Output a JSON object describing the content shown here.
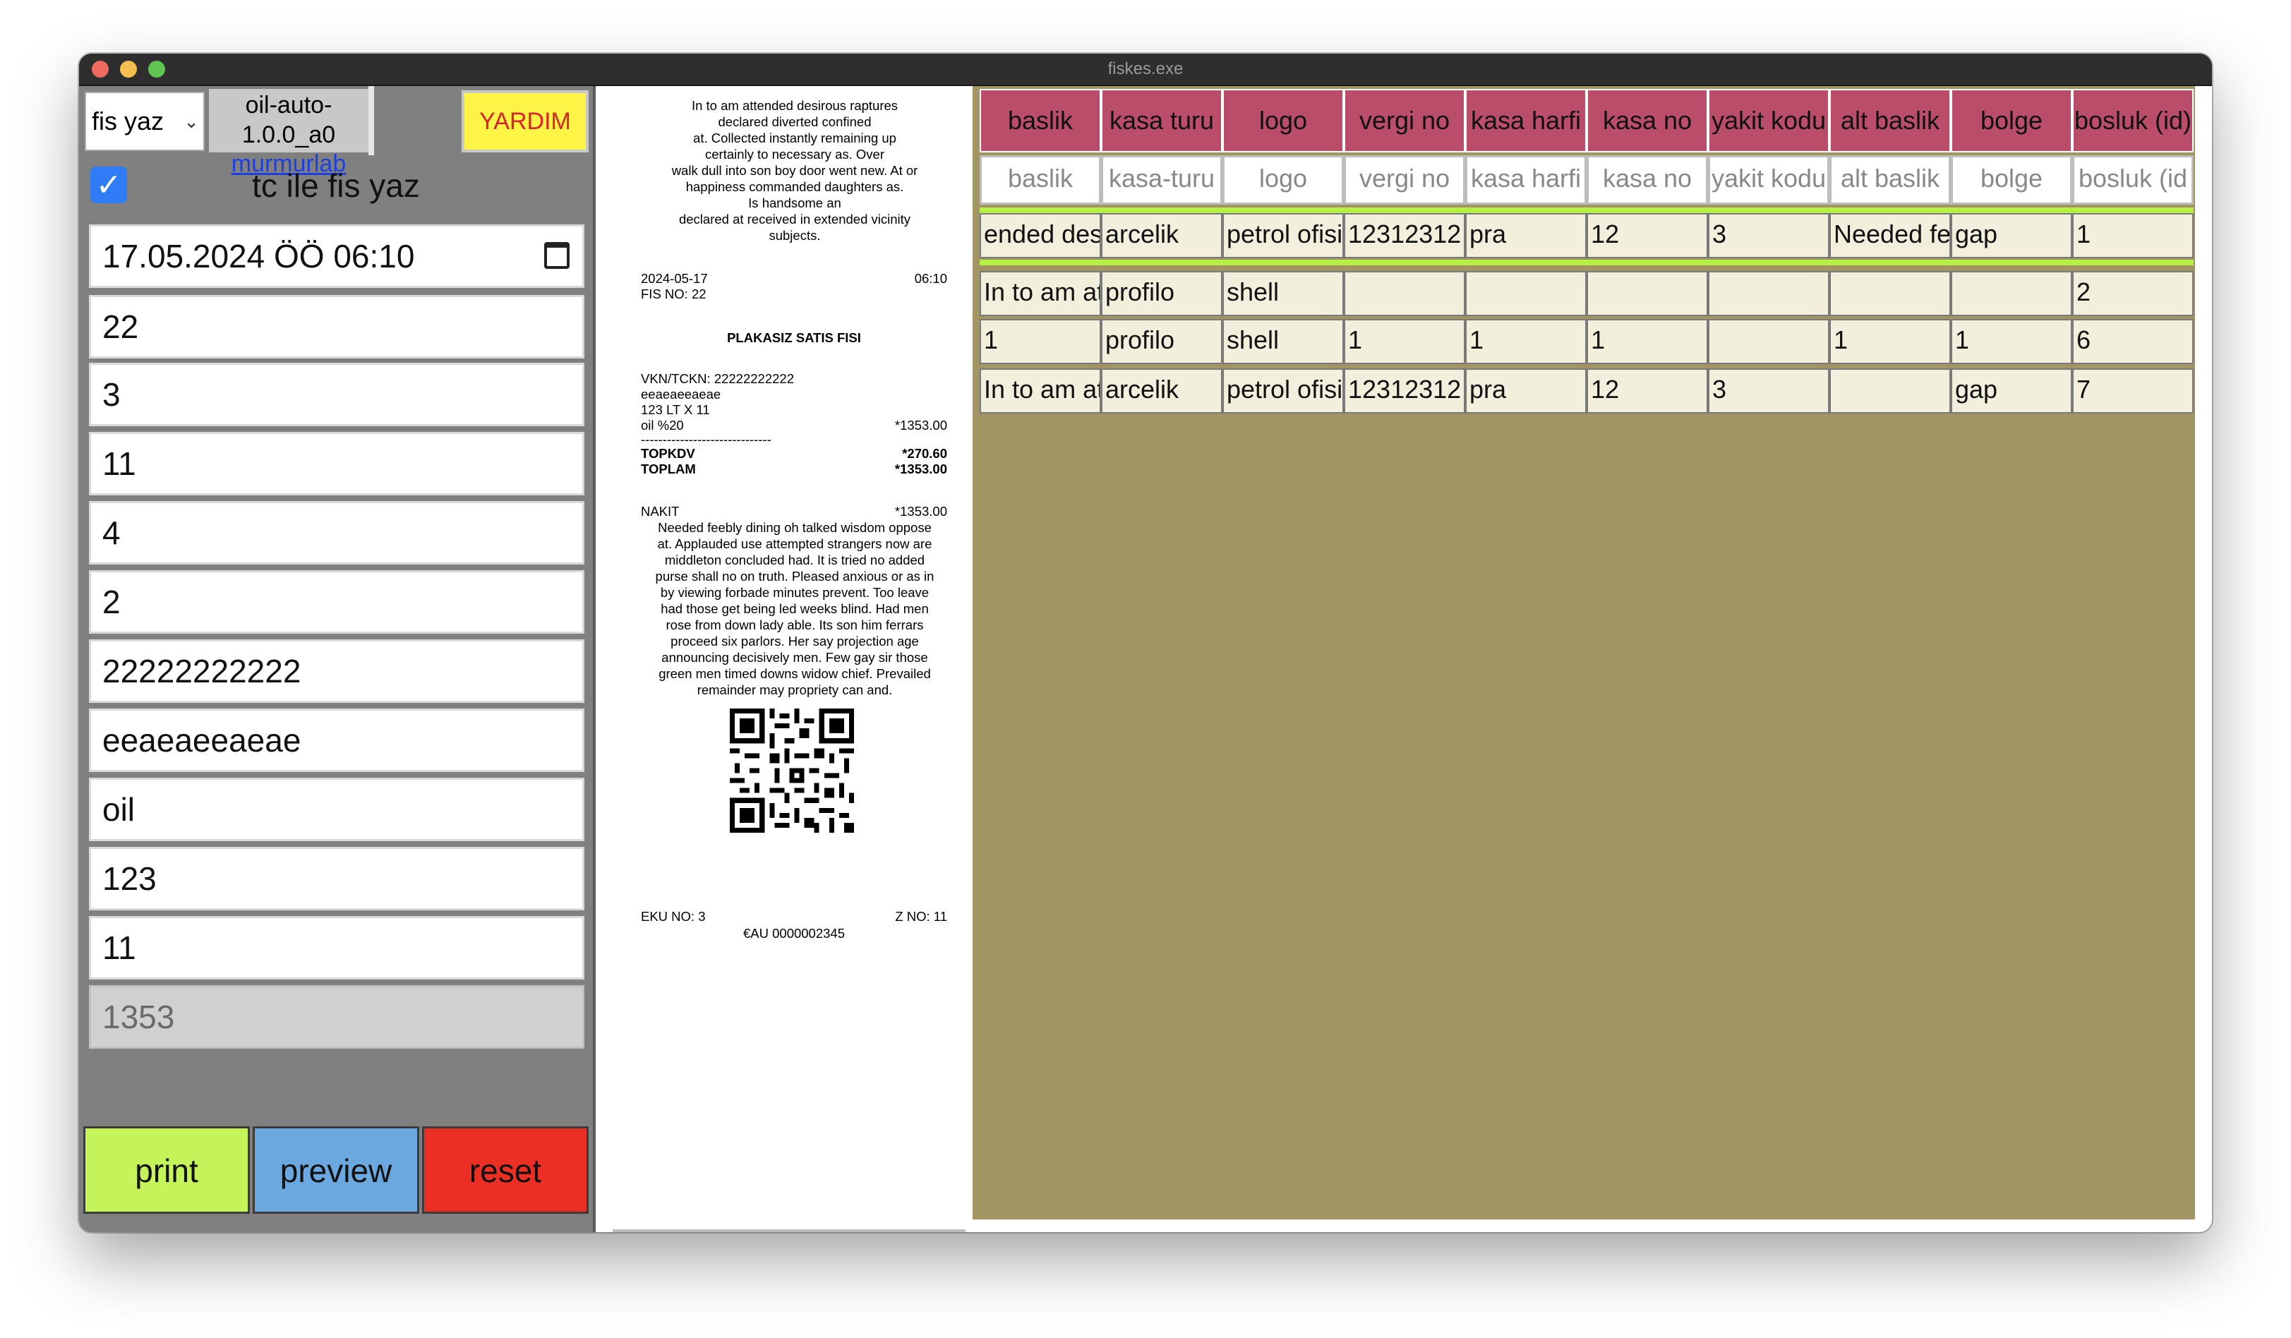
{
  "window": {
    "title": "fiskes.exe"
  },
  "left": {
    "select_value": "fis yaz",
    "version": "oil-auto-1.0.0_a0",
    "link": "murmurlab",
    "help_label": "YARDIM",
    "checkbox_checked": true,
    "checkbox_label": "tc ile fis yaz",
    "datetime": "17.05.2024 ÖÖ 06:10",
    "fields": [
      "22",
      "3",
      "11",
      "4",
      "2",
      "22222222222",
      "eeaeaeeaeae",
      "oil",
      "123",
      "11"
    ],
    "total_field": "1353",
    "buttons": {
      "print": "print",
      "preview": "preview",
      "reset": "reset"
    }
  },
  "receipt": {
    "header_lines": [
      "In to am attended desirous raptures",
      "declared diverted confined",
      "at. Collected instantly remaining up",
      "certainly to necessary as. Over",
      "walk dull into son boy door went new. At or",
      "happiness commanded daughters as.",
      "Is handsome an",
      "declared at received in extended vicinity",
      "subjects."
    ],
    "date": "2024-05-17",
    "time": "06:10",
    "fis_no": "FIS NO: 22",
    "title": "PLAKASIZ SATIS FISI",
    "vkn": "VKN/TCKN: 22222222222",
    "name": "eeaeaeeaeae",
    "qty_line": "123 LT X 11",
    "item_label": "oil %20",
    "item_amount": "*1353.00",
    "separator": "------------------------------",
    "topkdv_label": "TOPKDV",
    "topkdv_value": "*270.60",
    "toplam_label": "TOPLAM",
    "toplam_value": "*1353.00",
    "nakit_label": "NAKIT",
    "nakit_value": "*1353.00",
    "footer_lines": [
      "Needed feebly dining oh talked wisdom oppose",
      "at. Applauded use attempted strangers now are",
      "middleton concluded had. It is tried no added",
      "purse shall no on truth. Pleased anxious or as in",
      "by viewing forbade minutes prevent. Too leave",
      "had those get being led weeks blind. Had men",
      "rose from down lady able. Its son him ferrars",
      "proceed six parlors. Her say projection age",
      "announcing decisively men. Few gay sir those",
      "green men timed downs widow chief. Prevailed",
      "remainder may propriety can and."
    ],
    "eku": "EKU NO: 3",
    "z_no": "Z NO: 11",
    "eau": "€AU 0000002345"
  },
  "table": {
    "headers": [
      "baslik",
      "kasa turu",
      "logo",
      "vergi no",
      "kasa harfi",
      "kasa no",
      "yakit kodu",
      "alt baslik",
      "bolge",
      "bosluk (id)"
    ],
    "filters": [
      "baslik",
      "kasa-turu",
      "logo",
      "vergi no",
      "kasa harfi",
      "kasa no",
      "yakit kodu",
      "alt baslik",
      "bolge",
      "bosluk (id"
    ],
    "rows": [
      [
        "ended desi",
        "arcelik",
        "petrol ofisi",
        "12312312",
        "pra",
        "12",
        "3",
        "Needed fe",
        "gap",
        "1"
      ],
      [
        "In to am at",
        "profilo",
        "shell",
        "",
        "",
        "",
        "",
        "",
        "",
        "2"
      ],
      [
        "1",
        "profilo",
        "shell",
        "1",
        "1",
        "1",
        "",
        "1",
        "1",
        "6"
      ],
      [
        "In to am at",
        "arcelik",
        "petrol ofisi",
        "12312312",
        "pra",
        "12",
        "3",
        "",
        "gap",
        "7"
      ]
    ]
  },
  "colors": {
    "header_bg": "#ba4d6a",
    "table_bg": "#a19564",
    "row_bg": "#f2f0dc",
    "help_bg": "#fdf445",
    "print_bg": "#c5f35a",
    "preview_bg": "#6ba8df",
    "reset_bg": "#ec2f24"
  }
}
